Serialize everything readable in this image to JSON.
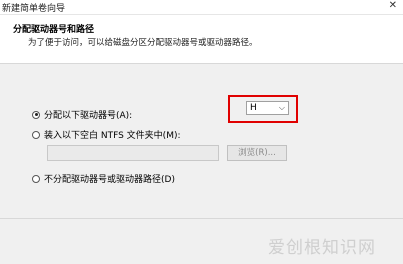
{
  "window": {
    "title": "新建简单卷向导",
    "close_glyph": "✕"
  },
  "header": {
    "title": "分配驱动器号和路径",
    "description": "为了便于访问，可以给磁盘分区分配驱动器号或驱动器路径。"
  },
  "options": {
    "assign_letter": {
      "label": "分配以下驱动器号(A):",
      "checked": true
    },
    "mount_folder": {
      "label": "装入以下空白 NTFS 文件夹中(M):",
      "checked": false
    },
    "no_assign": {
      "label": "不分配驱动器号或驱动器路径(D)",
      "checked": false
    }
  },
  "drive_select": {
    "value": "H",
    "chevron": "⌵"
  },
  "folder_input": {
    "value": ""
  },
  "browse_button": {
    "label": "浏览(R)..."
  },
  "watermark": {
    "text": "爱创根知识网"
  },
  "colors": {
    "highlight": "#e00000",
    "background": "#f0f0f0"
  }
}
